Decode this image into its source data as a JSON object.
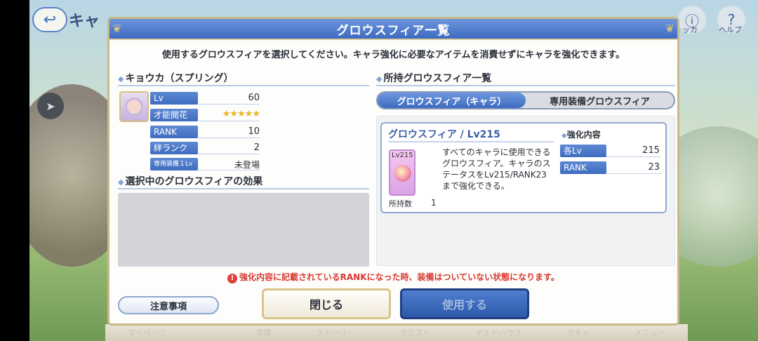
{
  "background": {
    "back_icon": "back-arrow-icon",
    "screen_title": "キャ",
    "top_icons": [
      {
        "icon": "info-icon",
        "label": "ッカ"
      },
      {
        "icon": "help-icon",
        "label": "ヘルプ"
      }
    ],
    "bottom_nav": [
      "マイページ",
      "",
      "冒険",
      "ストーリー",
      "クエスト",
      "ギルドハウス",
      "ガチャ",
      "メニュー"
    ]
  },
  "dialog": {
    "title": "グロウスフィア一覧",
    "subtitle": "使用するグロウスフィアを選択してください。キャラ強化に必要なアイテムを消費せずにキャラを強化できます。",
    "character": {
      "heading": "キョウカ（スプリング）",
      "stats": [
        {
          "label": "Lv",
          "value": "60"
        },
        {
          "label": "才能開花",
          "stars": 5
        },
        {
          "label": "RANK",
          "value": "10"
        },
        {
          "label": "絆ランク",
          "value": "2"
        },
        {
          "label": "専用装備１Lv",
          "value": "未登場"
        }
      ]
    },
    "effect_heading": "選択中のグロウスフィアの効果",
    "owned_heading": "所持グロウスフィア一覧",
    "tabs": [
      {
        "label": "グロウスフィア（キャラ）",
        "active": true
      },
      {
        "label": "専用装備グロウスフィア",
        "active": false
      }
    ],
    "item": {
      "title": "グロウスフィア / Lv215",
      "icon_label": "Lv215",
      "description": "すべてのキャラに使用できるグロウスフィア。キャラのステータスをLv215/RANK23まで強化できる。",
      "owned_label": "所持数",
      "owned_count": "1",
      "boost_heading": "強化内容",
      "boosts": [
        {
          "label": "各Lv",
          "value": "215"
        },
        {
          "label": "RANK",
          "value": "23"
        }
      ]
    },
    "warning": "強化内容に記載されているRANKになった時、装備はついていない状態になります。",
    "buttons": {
      "notes": "注意事項",
      "close": "閉じる",
      "use": "使用する"
    }
  }
}
